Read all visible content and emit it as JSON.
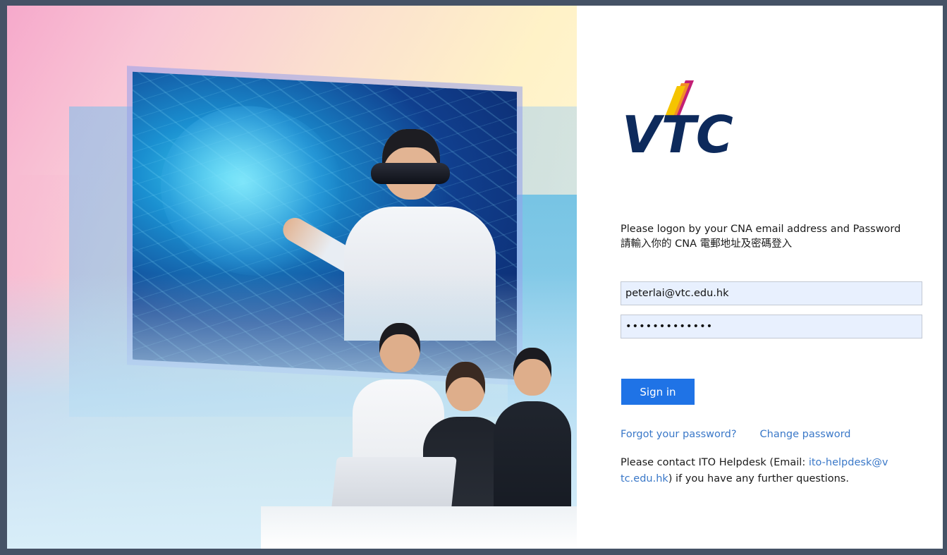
{
  "login": {
    "intro_en": "Please logon by your CNA email address and Password",
    "intro_zh": "請輸入你的 CNA 電郵地址及密碼登入",
    "email_value": "peterlai@vtc.edu.hk",
    "password_value": "•••••••••••••",
    "sign_in_label": "Sign in",
    "forgot_password_label": "Forgot your password?",
    "change_password_label": "Change password",
    "help_prefix": "Please contact ITO Helpdesk (Email: ",
    "help_email": "ito-helpdesk@vtc.edu.hk",
    "help_suffix": ") if you have any further questions."
  },
  "logo": {
    "text": "VTC",
    "colors": {
      "navy": "#0d2a5c",
      "orange": "#f28c28",
      "yellow": "#f5c400",
      "magenta": "#c21f75"
    }
  },
  "colors": {
    "primary_button": "#1f73e6",
    "link": "#3a78c8",
    "input_fill": "#e8f0fe",
    "outer_frame": "#455266"
  }
}
